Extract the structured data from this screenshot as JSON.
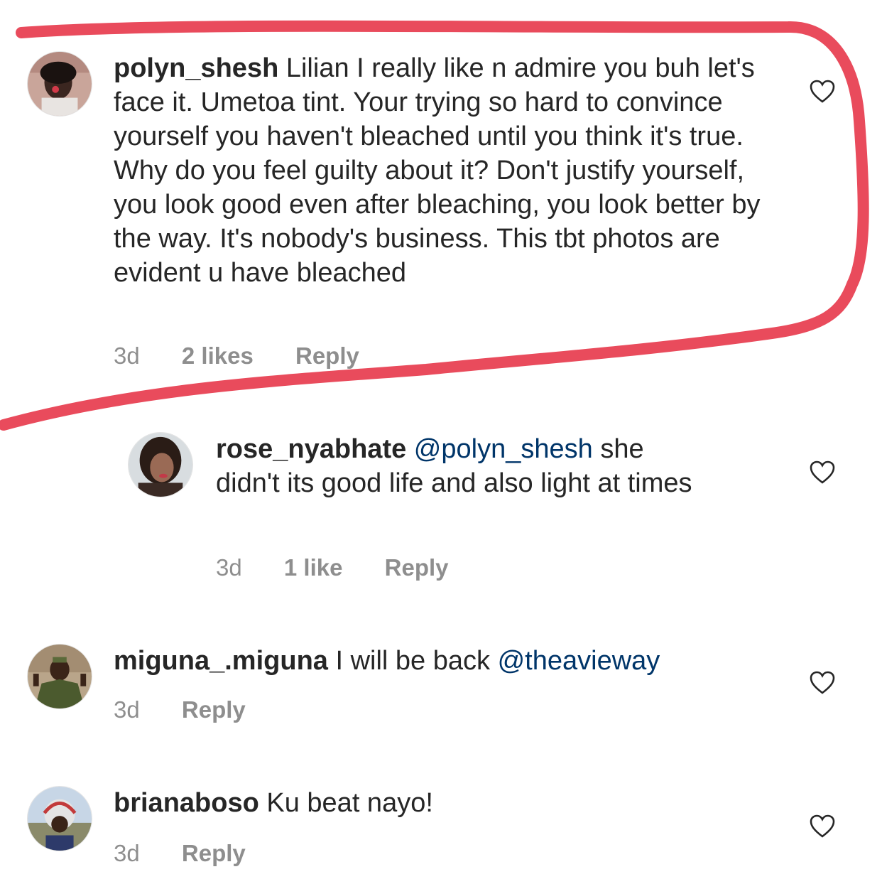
{
  "colors": {
    "text": "#262626",
    "meta": "#8e8e8e",
    "mention": "#003569",
    "annotation": "#e94b5c"
  },
  "comments": [
    {
      "username": "polyn_shesh",
      "text": "Lilian I really like n admire you buh let's face it. Umetoa tint. Your trying so hard to convince yourself you haven't bleached until you think it's true. Why do you feel guilty about it?  Don't justify yourself, you look good even after bleaching, you look better by the way. It's nobody's business. This tbt photos are evident u have bleached",
      "time": "3d",
      "likes": "2 likes",
      "reply": "Reply",
      "like_icon": "heart-outline-icon"
    },
    {
      "username": "rose_nyabhate",
      "mention": "@polyn_shesh",
      "text": "she didn't its good life and also light at times",
      "time": "3d",
      "likes": "1 like",
      "reply": "Reply",
      "like_icon": "heart-outline-icon"
    },
    {
      "username": "miguna_.miguna",
      "text": "I will be back",
      "mention": "@theavieway",
      "time": "3d",
      "reply": "Reply",
      "like_icon": "heart-outline-icon"
    },
    {
      "username": "brianaboso",
      "text": "Ku beat nayo!",
      "time": "3d",
      "reply": "Reply",
      "like_icon": "heart-outline-icon"
    }
  ]
}
